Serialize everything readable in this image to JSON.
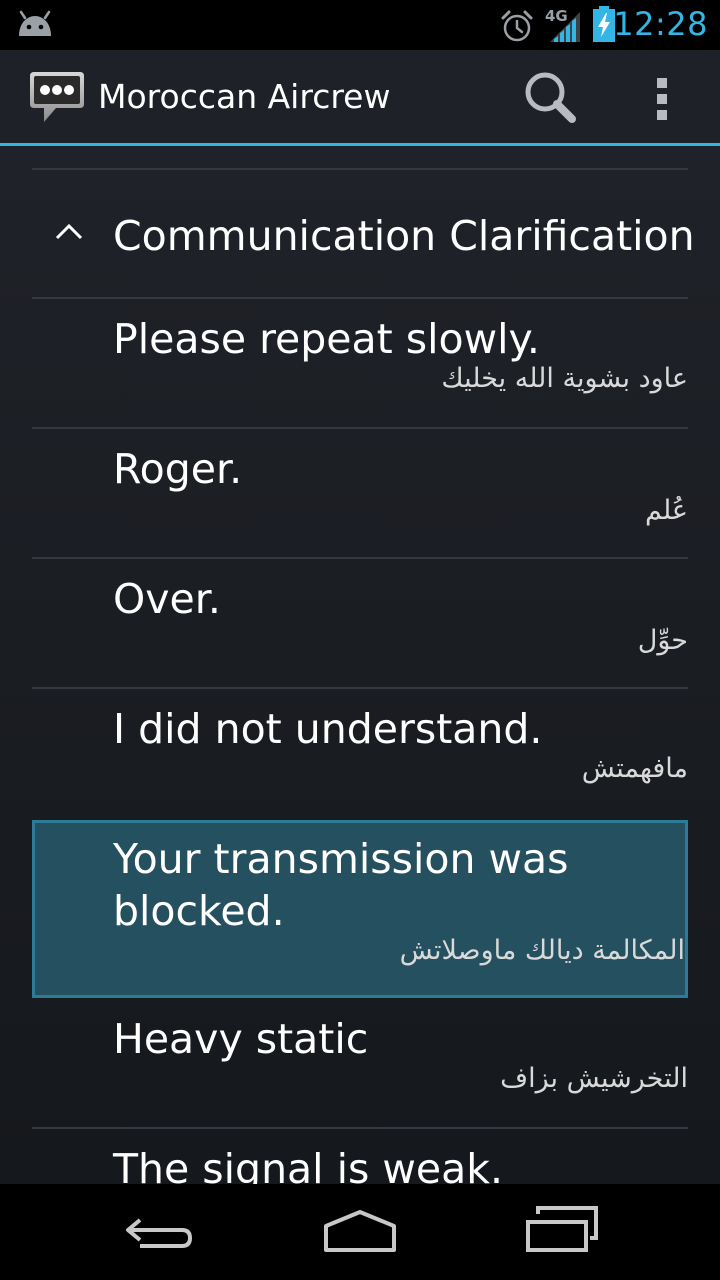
{
  "status_bar": {
    "network_type": "4G",
    "time": "12:28",
    "icons": [
      "android-icon",
      "alarm-icon",
      "signal-icon",
      "battery-charging-icon"
    ]
  },
  "action_bar": {
    "title": "Moroccan Aircrew",
    "icons": [
      "chat-bubble-icon",
      "search-icon",
      "overflow-menu-icon"
    ]
  },
  "group": {
    "title": "Communication Clarification",
    "icon": "chevron-up-icon"
  },
  "phrases": [
    {
      "en": "Please repeat slowly.",
      "ar": "عاود بشوية الله يخليك"
    },
    {
      "en": "Roger.",
      "ar": "عُلم"
    },
    {
      "en": "Over.",
      "ar": "حوِّل"
    },
    {
      "en": "I did not understand.",
      "ar": "مافهمتش"
    },
    {
      "en": "Your transmission was blocked.",
      "ar": "المكالمة ديالك ماوصلاتش",
      "selected": true
    },
    {
      "en": "Heavy static",
      "ar": "التخرشيش بزاف"
    },
    {
      "en": "The signal is weak.",
      "ar": ""
    }
  ],
  "nav_bar": {
    "icons": [
      "back-icon",
      "home-icon",
      "recents-icon"
    ]
  },
  "colors": {
    "accent": "#33b5e5",
    "selected_bg": "#25505f",
    "selected_border": "#2d7c97",
    "action_bar_bg": "#1e2127"
  }
}
